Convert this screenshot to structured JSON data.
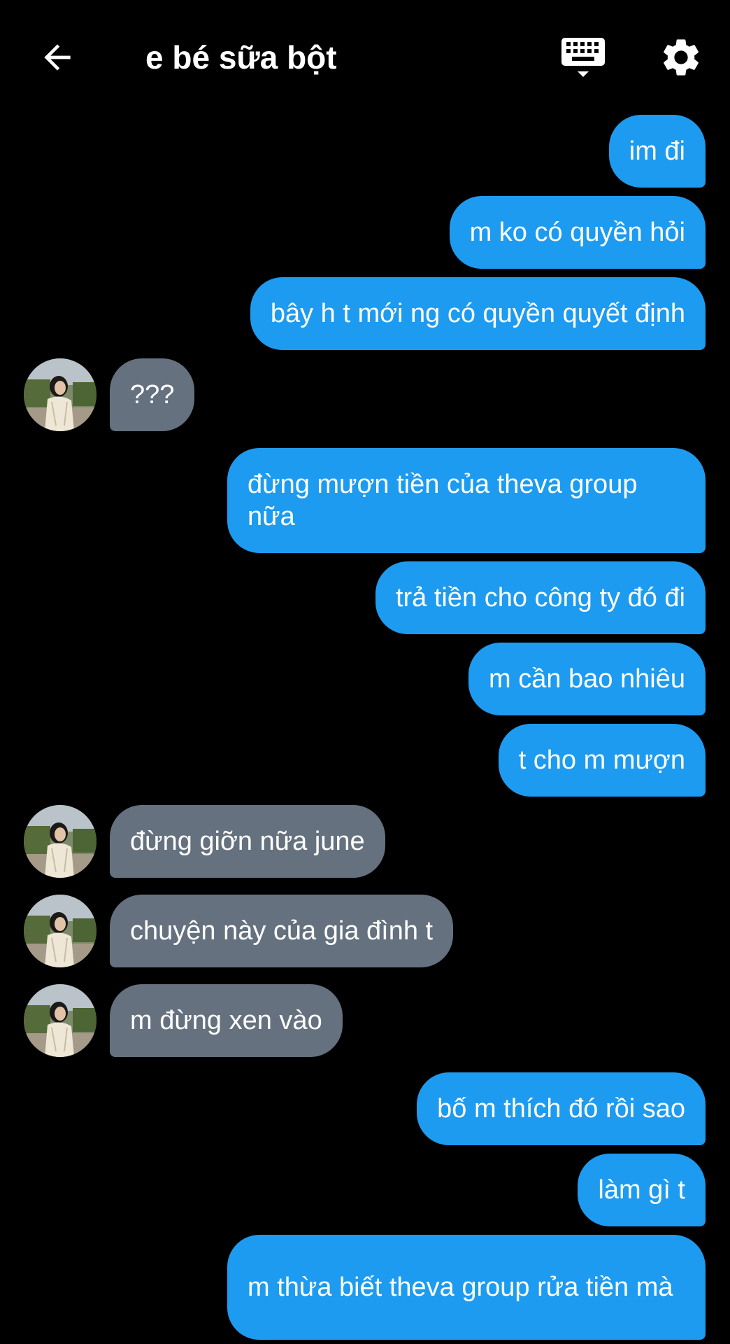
{
  "header": {
    "title": "e bé sữa bột",
    "back_icon": "arrow-left-icon",
    "keyboard_icon": "keyboard-icon",
    "settings_icon": "gear-icon"
  },
  "colors": {
    "background": "#000000",
    "sent_bubble": "#1d9bf0",
    "received_bubble": "#65717e",
    "text": "#ffffff"
  },
  "messages": [
    {
      "sender": "me",
      "text": "im đi"
    },
    {
      "sender": "me",
      "text": "m ko có quyền hỏi"
    },
    {
      "sender": "me",
      "text": "bây h t mới ng có quyền quyết định"
    },
    {
      "sender": "them",
      "text": "???"
    },
    {
      "sender": "me",
      "text": "đừng mượn tiền của theva group nữa"
    },
    {
      "sender": "me",
      "text": "trả tiền cho công ty đó đi"
    },
    {
      "sender": "me",
      "text": "m cần bao nhiêu"
    },
    {
      "sender": "me",
      "text": "t cho m mượn"
    },
    {
      "sender": "them",
      "text": "đừng giỡn nữa june"
    },
    {
      "sender": "them",
      "text": "chuyện này của gia đình t"
    },
    {
      "sender": "them",
      "text": "m đừng xen vào"
    },
    {
      "sender": "me",
      "text": "bố m thích đó rồi sao"
    },
    {
      "sender": "me",
      "text": "làm gì t"
    },
    {
      "sender": "me",
      "text": "m thừa biết theva group rửa tiền mà"
    }
  ]
}
